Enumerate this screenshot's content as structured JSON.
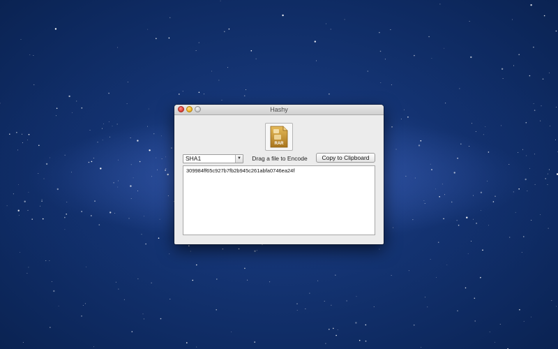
{
  "window": {
    "title": "Hashy"
  },
  "drop": {
    "icon_name": "rar-archive-icon",
    "icon_text": "RAR",
    "label": "Drag a file to Encode"
  },
  "algorithm": {
    "selected": "SHA1"
  },
  "toolbar": {
    "copy_label": "Copy to Clipboard"
  },
  "output": {
    "hash": "309984ff65c927b7fb2b945c261abfa0746ea24f"
  },
  "colors": {
    "desktop_background": "#0e2a61",
    "window_background": "#ececec",
    "close_button": "#e0443a",
    "minimize_button": "#f2b526",
    "icon_gold": "#c9962c"
  }
}
